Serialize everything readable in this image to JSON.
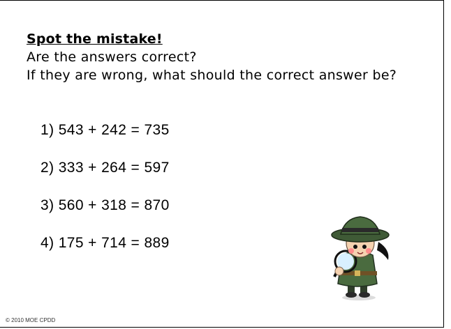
{
  "title": "Spot the mistake!",
  "instructions": [
    "Are the answers correct?",
    "If they are wrong, what should the correct answer be?"
  ],
  "questions": [
    "1) 543 + 242 = 735",
    "2) 333 + 264 = 597",
    "3) 560 + 318 = 870",
    "4) 175 + 714 = 889"
  ],
  "footer": "© 2010 MOE CPDD",
  "illustration": {
    "name": "detective-with-magnifying-glass",
    "colors": {
      "coat": "#4a6b3f",
      "hat": "#3f5a36",
      "hair": "#111111",
      "skin": "#f5d2b0",
      "cheek": "#ff8b8b",
      "lens": "#d9f0ff"
    }
  }
}
